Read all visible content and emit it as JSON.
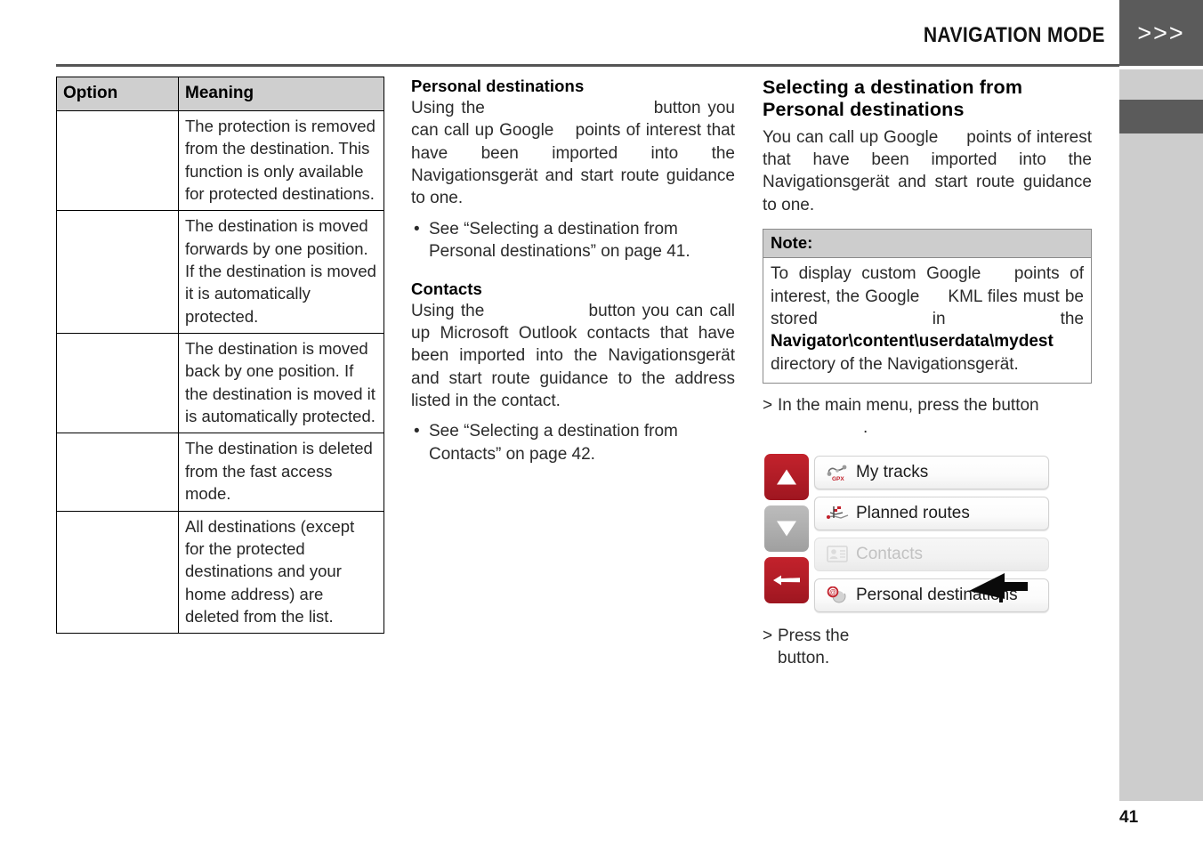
{
  "header": {
    "title": "NAVIGATION MODE",
    "chevrons": ">>>"
  },
  "page_number": "41",
  "table": {
    "headers": [
      "Option",
      "Meaning"
    ],
    "rows": [
      {
        "option": "",
        "meaning": "The protection is removed from the destination. This function is only available for protected destinations."
      },
      {
        "option": "",
        "meaning": "The destination is moved forwards by one position. If the destination is moved it is automatically protected."
      },
      {
        "option": "",
        "meaning": "The destination is moved back by one position. If the destination is moved it is automatically protected."
      },
      {
        "option": "",
        "meaning": "The destination is deleted from the fast access mode."
      },
      {
        "option": "",
        "meaning": "All destinations (except for the protected destinations and your home address) are deleted from the list."
      }
    ]
  },
  "middle": {
    "personal": {
      "heading": "Personal destinations",
      "p1_a": "Using the",
      "p1_b": "button you can call up Google",
      "p1_c": "points of interest that have been imported into the Navigationsgerät and start route guidance to one.",
      "bullet": "See  “Selecting a destination from Personal destinations” on page 41."
    },
    "contacts": {
      "heading": "Contacts",
      "p1_a": "Using the",
      "p1_b": "button you can call up Microsoft  Outlook   contacts that have been imported into the Navigationsgerät and start route guidance to the address listed in the contact.",
      "bullet": "See  “Selecting a destination from Contacts” on page 42."
    }
  },
  "right": {
    "heading": "Selecting a destination from Personal destinations",
    "intro_a": "You can call up Google",
    "intro_b": "points of interest that have been imported into the Navigationsgerät and start route guidance to one.",
    "note": {
      "label": "Note:",
      "text_a": "To display custom Google",
      "text_b": "points of interest, the Google",
      "text_c": "KML files must be stored in the",
      "path": "Navigator\\content\\userdata\\mydest",
      "text_d": "directory of the Navigationsgerät."
    },
    "step1": "In the main menu, press the button",
    "step1_cont": ".",
    "step2": "Press    the",
    "step2_cont": "button."
  },
  "device_screenshot": {
    "buttons": {
      "up": "scroll-up",
      "down": "scroll-down",
      "back": "back"
    },
    "menu_items": [
      {
        "label": "My tracks",
        "icon": "gpx-tracks-icon",
        "disabled": false
      },
      {
        "label": "Planned routes",
        "icon": "planned-routes-icon",
        "disabled": false
      },
      {
        "label": "Contacts",
        "icon": "contacts-icon",
        "disabled": true
      },
      {
        "label": "Personal destinations",
        "icon": "personal-destinations-icon",
        "disabled": false
      }
    ]
  },
  "colors": {
    "accent_red": "#b01c26",
    "header_dark": "#5b5b5b",
    "band_light": "#cdcdcd",
    "table_header": "#cfcfcf"
  }
}
